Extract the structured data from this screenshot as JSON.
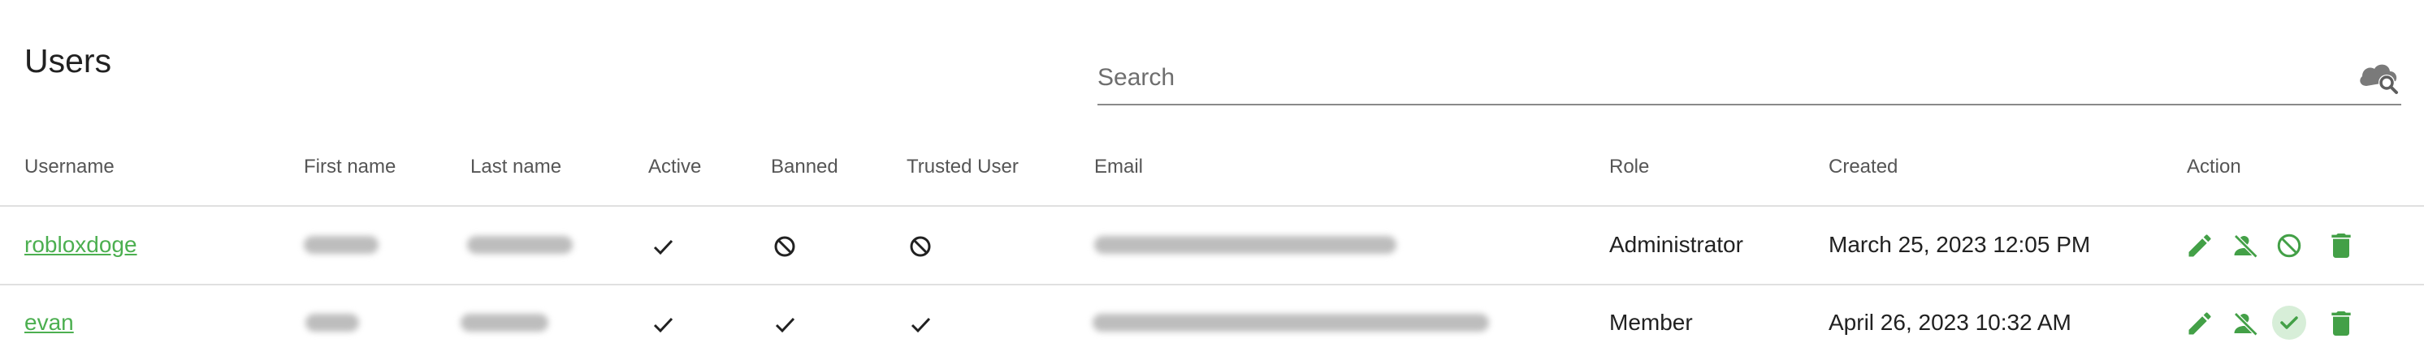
{
  "page": {
    "title": "Users"
  },
  "search": {
    "placeholder": "Search",
    "value": "",
    "icon": "cloud-search-icon"
  },
  "table": {
    "columns": [
      "Username",
      "First name",
      "Last name",
      "Active",
      "Banned",
      "Trusted User",
      "Email",
      "Role",
      "Created",
      "Action"
    ],
    "rows": [
      {
        "username": "robloxdoge",
        "active": "check",
        "banned": "block",
        "trusted": "block",
        "role": "Administrator",
        "created": "March 25, 2023 12:05 PM",
        "status_action": "ban"
      },
      {
        "username": "evan",
        "active": "check",
        "banned": "check",
        "trusted": "check",
        "role": "Member",
        "created": "April 26, 2023 10:32 AM",
        "status_action": "unban"
      }
    ]
  },
  "colors": {
    "accent": "#4caf50",
    "accent_dark": "#43a047",
    "divider": "#e0e0e0",
    "highlight": "#d7eed8"
  },
  "icons": [
    "check-icon",
    "block-icon",
    "edit-icon",
    "user-remove-icon",
    "ban-icon",
    "approve-icon",
    "delete-icon"
  ]
}
